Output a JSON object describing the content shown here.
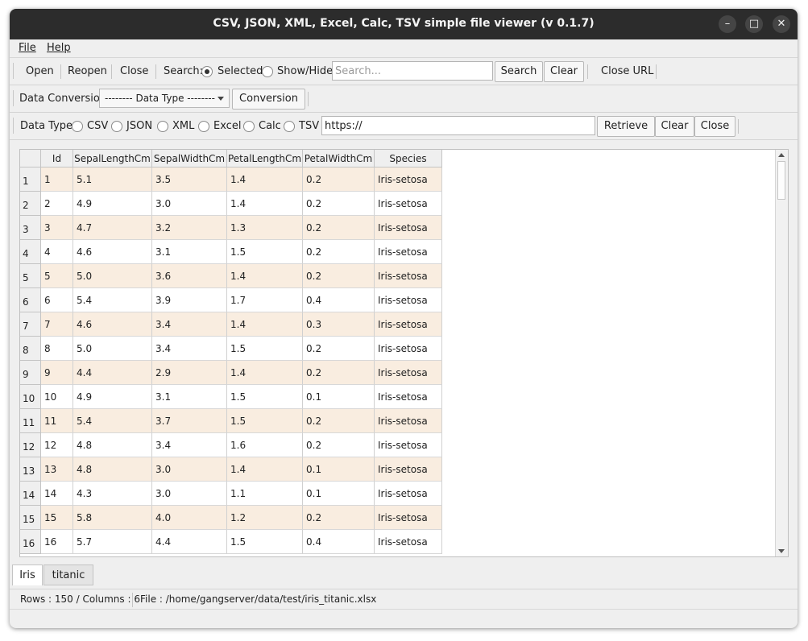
{
  "window": {
    "title": "CSV, JSON, XML, Excel, Calc, TSV simple file viewer (v 0.1.7)",
    "minimize": "–",
    "maximize": "□",
    "close": "✕"
  },
  "menubar": {
    "file": "File",
    "help": "Help"
  },
  "toolbar1": {
    "open": "Open",
    "reopen": "Reopen",
    "close": "Close",
    "search_label": "Search:",
    "radio_selected": "Selected",
    "radio_showhide": "Show/Hide",
    "search_placeholder": "Search...",
    "search_button": "Search",
    "clear_button": "Clear",
    "close_url": "Close URL"
  },
  "toolbar2": {
    "label": "Data Conversion:",
    "combo_value": "--------  Data Type  --------",
    "conversion_button": "Conversion"
  },
  "toolbar3": {
    "label": "Data Type:",
    "types": [
      "CSV",
      "JSON",
      "XML",
      "Excel",
      "Calc",
      "TSV"
    ],
    "url_value": "https://",
    "retrieve": "Retrieve",
    "clear": "Clear",
    "close": "Close"
  },
  "table": {
    "columns": [
      "Id",
      "SepalLengthCm",
      "SepalWidthCm",
      "PetalLengthCm",
      "PetalWidthCm",
      "Species"
    ],
    "rows": [
      [
        "1",
        "1",
        "5.1",
        "3.5",
        "1.4",
        "0.2",
        "Iris-setosa"
      ],
      [
        "2",
        "2",
        "4.9",
        "3.0",
        "1.4",
        "0.2",
        "Iris-setosa"
      ],
      [
        "3",
        "3",
        "4.7",
        "3.2",
        "1.3",
        "0.2",
        "Iris-setosa"
      ],
      [
        "4",
        "4",
        "4.6",
        "3.1",
        "1.5",
        "0.2",
        "Iris-setosa"
      ],
      [
        "5",
        "5",
        "5.0",
        "3.6",
        "1.4",
        "0.2",
        "Iris-setosa"
      ],
      [
        "6",
        "6",
        "5.4",
        "3.9",
        "1.7",
        "0.4",
        "Iris-setosa"
      ],
      [
        "7",
        "7",
        "4.6",
        "3.4",
        "1.4",
        "0.3",
        "Iris-setosa"
      ],
      [
        "8",
        "8",
        "5.0",
        "3.4",
        "1.5",
        "0.2",
        "Iris-setosa"
      ],
      [
        "9",
        "9",
        "4.4",
        "2.9",
        "1.4",
        "0.2",
        "Iris-setosa"
      ],
      [
        "10",
        "10",
        "4.9",
        "3.1",
        "1.5",
        "0.1",
        "Iris-setosa"
      ],
      [
        "11",
        "11",
        "5.4",
        "3.7",
        "1.5",
        "0.2",
        "Iris-setosa"
      ],
      [
        "12",
        "12",
        "4.8",
        "3.4",
        "1.6",
        "0.2",
        "Iris-setosa"
      ],
      [
        "13",
        "13",
        "4.8",
        "3.0",
        "1.4",
        "0.1",
        "Iris-setosa"
      ],
      [
        "14",
        "14",
        "4.3",
        "3.0",
        "1.1",
        "0.1",
        "Iris-setosa"
      ],
      [
        "15",
        "15",
        "5.8",
        "4.0",
        "1.2",
        "0.2",
        "Iris-setosa"
      ],
      [
        "16",
        "16",
        "5.7",
        "4.4",
        "1.5",
        "0.4",
        "Iris-setosa"
      ]
    ],
    "stripe_color": "#f9ede0"
  },
  "tabs": [
    "Iris",
    "titanic"
  ],
  "status": {
    "rows_cols": "Rows : 150 / Columns : 6",
    "file": "File : /home/gangserver/data/test/iris_titanic.xlsx"
  }
}
